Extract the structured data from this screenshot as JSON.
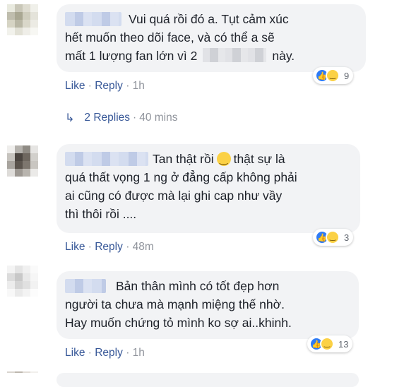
{
  "comments": [
    {
      "lines": [
        "Vui quá rồi đó a. Tụt cảm xúc",
        "hết muốn theo dõi face, và có thể a sẽ",
        "mất 1 lượng fan lớn vì 2",
        "này."
      ],
      "reaction_count": "9",
      "like_label": "Like",
      "reply_label": "Reply",
      "time": "1h",
      "replies": {
        "label": "2 Replies",
        "time": "40 mins"
      }
    },
    {
      "lines": [
        "Tan thật rồi",
        "thật sự là",
        "quá thất vọng 1 ng ở đẳng cấp không phải",
        "ai cũng có được mà lại ghi cap như vầy",
        "thì thôi rồi ...."
      ],
      "reaction_count": "3",
      "like_label": "Like",
      "reply_label": "Reply",
      "time": "48m"
    },
    {
      "lines": [
        "Bản thân mình có tốt đẹp hơn",
        "người ta chưa mà mạnh miệng thế nhờ.",
        "Hay muốn chứng tỏ mình ko sợ ai..khinh."
      ],
      "reaction_count": "13",
      "like_label": "Like",
      "reply_label": "Reply",
      "time": "1h"
    }
  ],
  "separator": "·",
  "icons": {
    "like": "thumbs-up-icon",
    "haha": "laughing-face-icon",
    "reply_arrow": "reply-arrow-icon",
    "smile": "smiling-face-emoji"
  },
  "colors": {
    "link": "#385898",
    "meta": "#90949c",
    "bubble": "#f2f3f5",
    "like_blue": "#2e7bf6",
    "haha_yellow": "#fbd145"
  }
}
